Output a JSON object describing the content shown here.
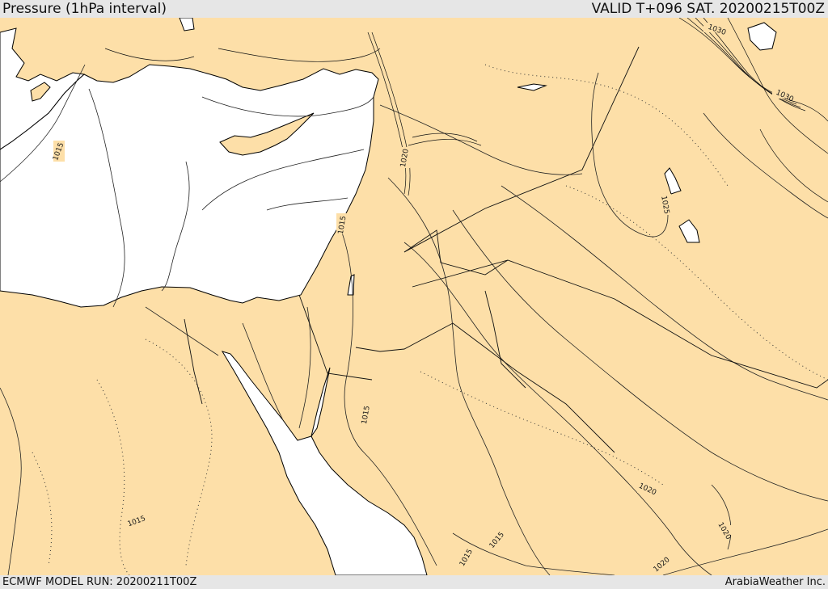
{
  "header": {
    "title": "Pressure (1hPa interval)",
    "valid": "VALID T+096 SAT. 20200215T00Z"
  },
  "footer": {
    "model_run": "ECMWF MODEL RUN: 20200211T00Z",
    "credit": "ArabiaWeather Inc."
  },
  "map": {
    "colors": {
      "land": "#fddfa8",
      "water": "#ffffff",
      "coast": "#000000",
      "isobar": "#222222",
      "border": "#111111"
    },
    "isobar_labels": [
      "1030",
      "1030",
      "1020",
      "1025",
      "1015",
      "1015",
      "1015",
      "1015",
      "1015",
      "1020",
      "1020",
      "1020",
      "1015"
    ]
  }
}
